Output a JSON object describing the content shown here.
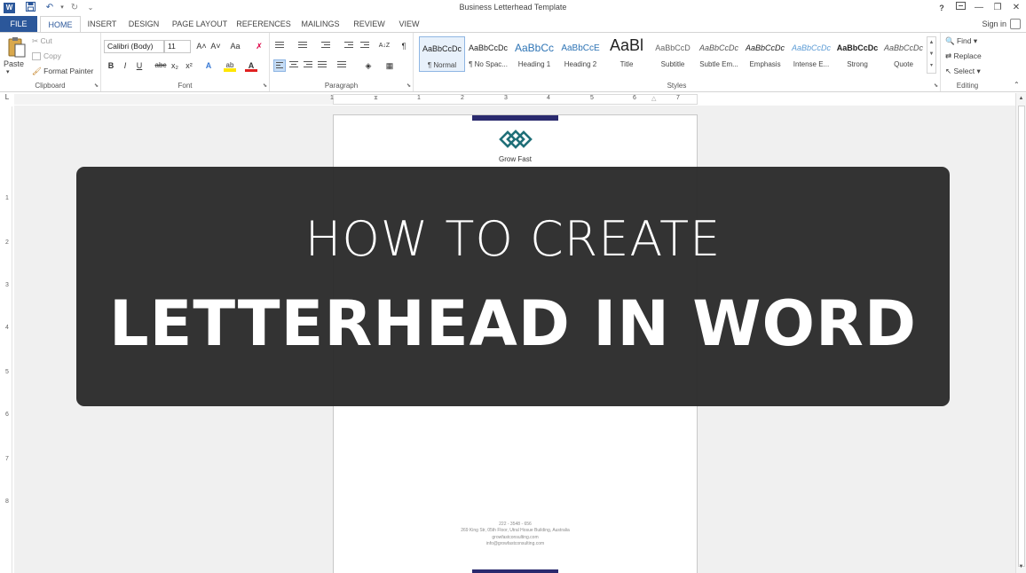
{
  "window": {
    "title": "Business Letterhead Template",
    "help": "?",
    "restore_ribbon": "⧉",
    "minimize": "—",
    "maximize": "❐",
    "close": "✕"
  },
  "quick_access": {
    "app_icon": "W",
    "save": "💾",
    "undo": "↶",
    "redo": "↻",
    "customize": "⌄"
  },
  "tabs": [
    {
      "label": "FILE"
    },
    {
      "label": "HOME"
    },
    {
      "label": "INSERT"
    },
    {
      "label": "DESIGN"
    },
    {
      "label": "PAGE LAYOUT"
    },
    {
      "label": "REFERENCES"
    },
    {
      "label": "MAILINGS"
    },
    {
      "label": "REVIEW"
    },
    {
      "label": "VIEW"
    }
  ],
  "signin": "Sign in",
  "clipboard": {
    "label": "Clipboard",
    "paste": "Paste",
    "cut": "Cut",
    "copy": "Copy",
    "format_painter": "Format Painter"
  },
  "font": {
    "label": "Font",
    "family": "Calibri (Body)",
    "size": "11",
    "grow": "A˄",
    "shrink": "A˅",
    "case": "Aa",
    "clear": "✗",
    "bold": "B",
    "italic": "I",
    "underline": "U",
    "strike": "abc",
    "subscript": "x₂",
    "superscript": "x²",
    "text_effects": "A",
    "highlight": "ab",
    "font_color": "A"
  },
  "paragraph": {
    "label": "Paragraph",
    "show_marks": "¶",
    "sort": "A↓Z"
  },
  "styles": {
    "label": "Styles",
    "items": [
      {
        "sample": "AaBbCcDc",
        "name": "¶ Normal"
      },
      {
        "sample": "AaBbCcDc",
        "name": "¶ No Spac..."
      },
      {
        "sample": "AaBbCc",
        "name": "Heading 1"
      },
      {
        "sample": "AaBbCcE",
        "name": "Heading 2"
      },
      {
        "sample": "AaBl",
        "name": "Title"
      },
      {
        "sample": "AaBbCcD",
        "name": "Subtitle"
      },
      {
        "sample": "AaBbCcDc",
        "name": "Subtle Em..."
      },
      {
        "sample": "AaBbCcDc",
        "name": "Emphasis"
      },
      {
        "sample": "AaBbCcDc",
        "name": "Intense E..."
      },
      {
        "sample": "AaBbCcDc",
        "name": "Strong"
      },
      {
        "sample": "AaBbCcDc",
        "name": "Quote"
      }
    ]
  },
  "editing": {
    "label": "Editing",
    "find": "Find",
    "replace": "Replace",
    "select": "Select"
  },
  "ruler": {
    "corner": "L",
    "h_ticks": [
      "1",
      "1",
      "2",
      "3",
      "4",
      "5",
      "6",
      "7"
    ],
    "v_ticks": [
      "1",
      "1",
      "2",
      "3",
      "4",
      "5",
      "6",
      "7",
      "8"
    ]
  },
  "document": {
    "company": "Grow Fast",
    "footer": {
      "phone": "222 - 3548 - 656",
      "address": "269 King Str, 05th Floor, Utral Hosue Building, Australia",
      "web": "growfastconsulting.com",
      "email": "info@growfastconsulting.com"
    }
  },
  "overlay": {
    "line1": "HOW TO CREATE",
    "line2": "LETTERHEAD IN WORD"
  },
  "colors": {
    "word_blue": "#2b579a",
    "overlay_bg": "#2b2b2b",
    "page_bar": "#2a2a6e",
    "logo_teal": "#1f6f78"
  }
}
